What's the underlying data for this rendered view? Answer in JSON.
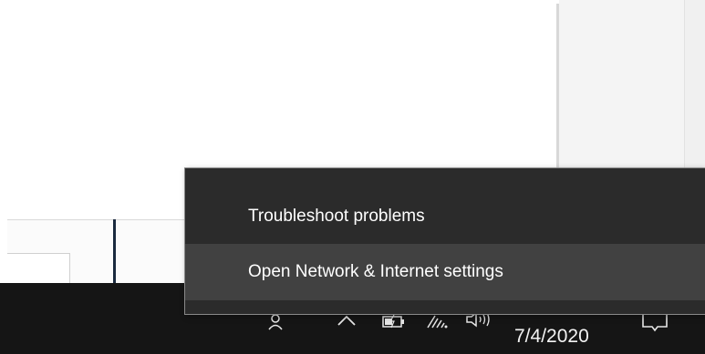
{
  "context_menu": {
    "items": [
      {
        "label": "Troubleshoot problems"
      },
      {
        "label": "Open Network & Internet settings"
      }
    ]
  },
  "taskbar": {
    "date": "7/4/2020",
    "icons": [
      "people-icon",
      "chevron-up-icon",
      "battery-icon",
      "wifi-icon",
      "volume-icon",
      "notification-icon"
    ]
  },
  "colors": {
    "menu_bg": "#2b2b2b",
    "menu_highlight": "#414141",
    "taskbar_bg": "#151515"
  }
}
